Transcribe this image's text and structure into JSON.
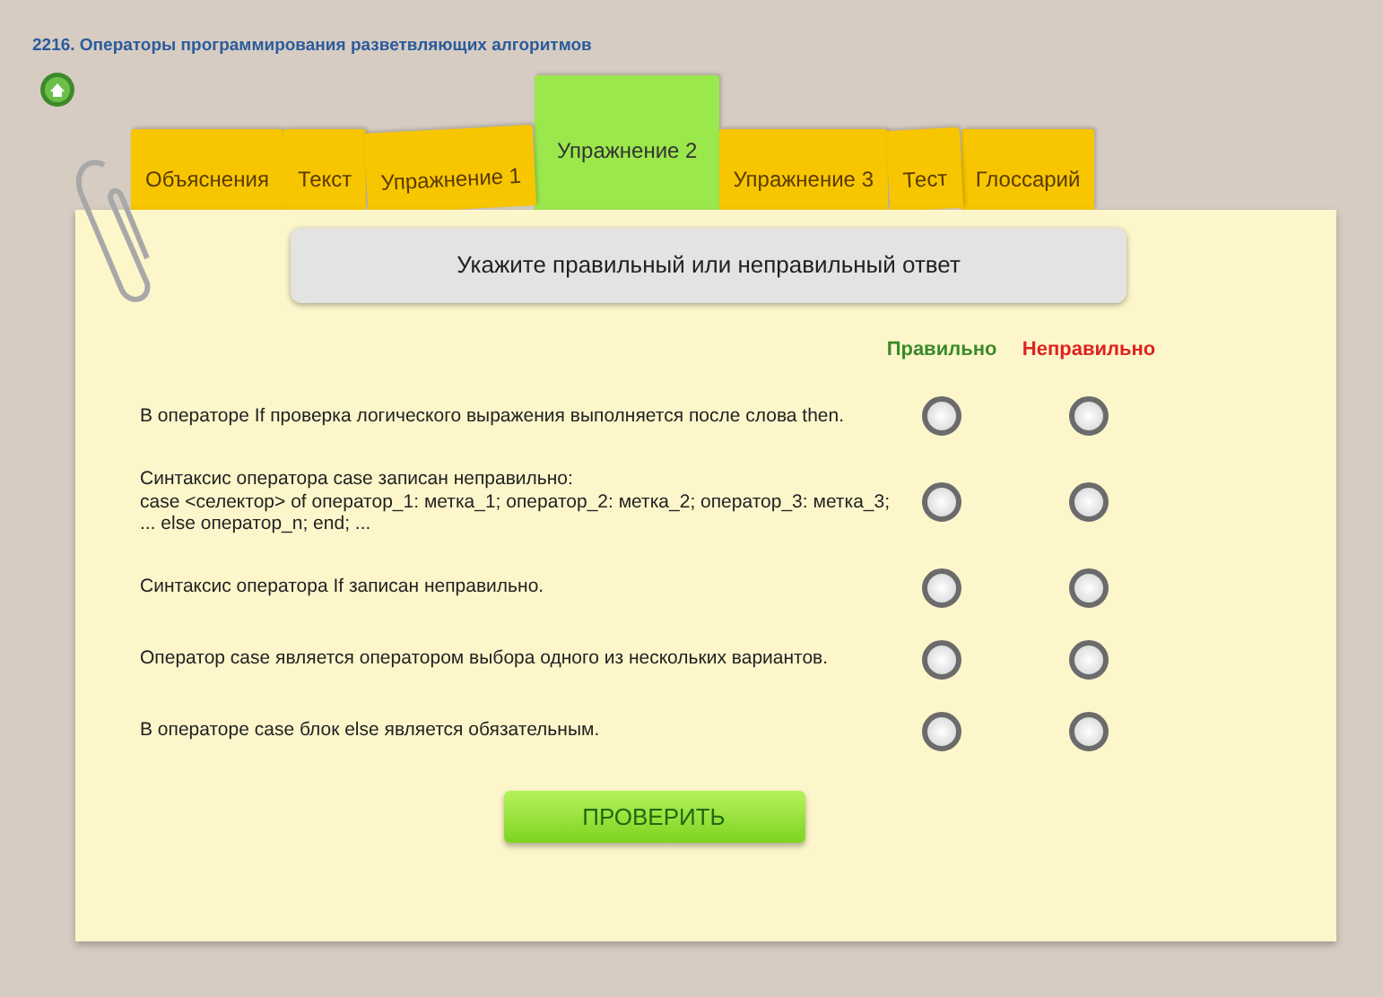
{
  "header": {
    "title": "2216. Операторы программирования разветвляющих алгоритмов"
  },
  "tabs": [
    {
      "label": "Объяснения",
      "selected": false
    },
    {
      "label": "Текст",
      "selected": false
    },
    {
      "label": "Упражнение 1",
      "selected": false
    },
    {
      "label": "Упражнение 2",
      "selected": true
    },
    {
      "label": "Упражнение 3",
      "selected": false
    },
    {
      "label": "Тест",
      "selected": false
    },
    {
      "label": "Глоссарий",
      "selected": false
    }
  ],
  "instruction": "Укажите правильный или неправильный ответ",
  "columns": [
    {
      "label": "Правильно",
      "color": "#3a8a2a"
    },
    {
      "label": "Неправильно",
      "color": "#e02020"
    }
  ],
  "questions": [
    {
      "text": "В операторе If проверка логического выражения  выполняется после слова then.",
      "options": [
        {
          "selected": false
        },
        {
          "selected": false
        }
      ]
    },
    {
      "text": "Синтаксис оператора case записан неправильно:\ncase <селектор> of оператор_1: метка_1; оператор_2: метка_2; оператор_3: метка_3; ... else оператор_n; end; ...",
      "options": [
        {
          "selected": false
        },
        {
          "selected": false
        }
      ]
    },
    {
      "text": "Синтаксис оператора If записан неправильно.",
      "options": [
        {
          "selected": false
        },
        {
          "selected": false
        }
      ]
    },
    {
      "text": "Оператор case является оператором выбора одного из нескольких вариантов.",
      "options": [
        {
          "selected": false
        },
        {
          "selected": false
        }
      ]
    },
    {
      "text": "В операторе case блок else является обязательным.",
      "options": [
        {
          "selected": false
        },
        {
          "selected": false
        }
      ]
    }
  ],
  "check_button": "ПРОВЕРИТЬ"
}
